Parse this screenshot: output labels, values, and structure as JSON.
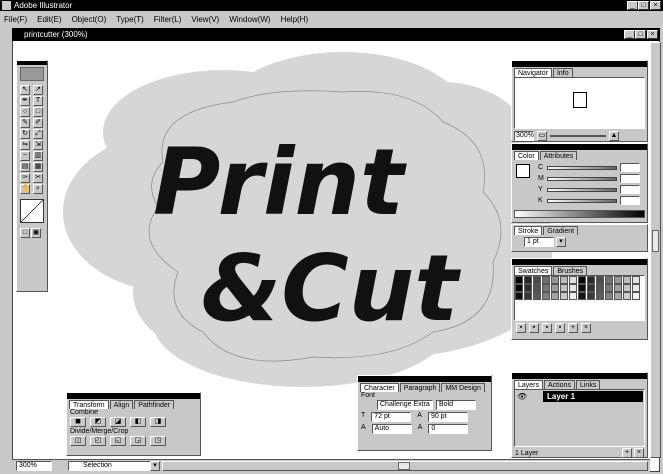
{
  "app": {
    "title": "Adobe Illustrator"
  },
  "menu": [
    "File(F)",
    "Edit(E)",
    "Object(O)",
    "Type(T)",
    "Filter(L)",
    "View(V)",
    "Window(W)",
    "Help(H)"
  ],
  "document": {
    "title": "printcutter (300%)"
  },
  "artwork": {
    "line1": "Print",
    "line2": "&Cut"
  },
  "navigator": {
    "tabs": [
      "Navigator",
      "Info"
    ],
    "zoom": "300%"
  },
  "color": {
    "tabs": [
      "Color",
      "Attributes"
    ],
    "channels": [
      "C",
      "M",
      "Y",
      "K"
    ]
  },
  "stroke": {
    "tabs": [
      "Stroke",
      "Gradient"
    ],
    "weight": "1 pt"
  },
  "swatches": {
    "tabs": [
      "Swatches",
      "Brushes"
    ]
  },
  "layers": {
    "tabs": [
      "Layers",
      "Actions",
      "Links"
    ],
    "layer_name": "Layer 1",
    "footer": "1 Layer"
  },
  "pathfinder": {
    "tabs": [
      "Transform",
      "Align",
      "Pathfinder"
    ],
    "combine_label": "Combine",
    "divide_label": "Divide/Merge/Crop"
  },
  "character": {
    "tabs": [
      "Character",
      "Paragraph",
      "MM Design"
    ],
    "font_label": "Font",
    "font_value": "Challenge Extra",
    "style_value": "Bold",
    "size": "72 pt",
    "leading": "90 pt",
    "kerning": "Auto",
    "tracking": "0"
  },
  "status": {
    "zoom": "300%",
    "mode": "Selection"
  },
  "colors": {
    "title": "#000000",
    "canvas": "#ffffff",
    "chrome": "#c8c8c8",
    "blob": "#d6d6d6",
    "cutline": "#8a8a8a"
  }
}
